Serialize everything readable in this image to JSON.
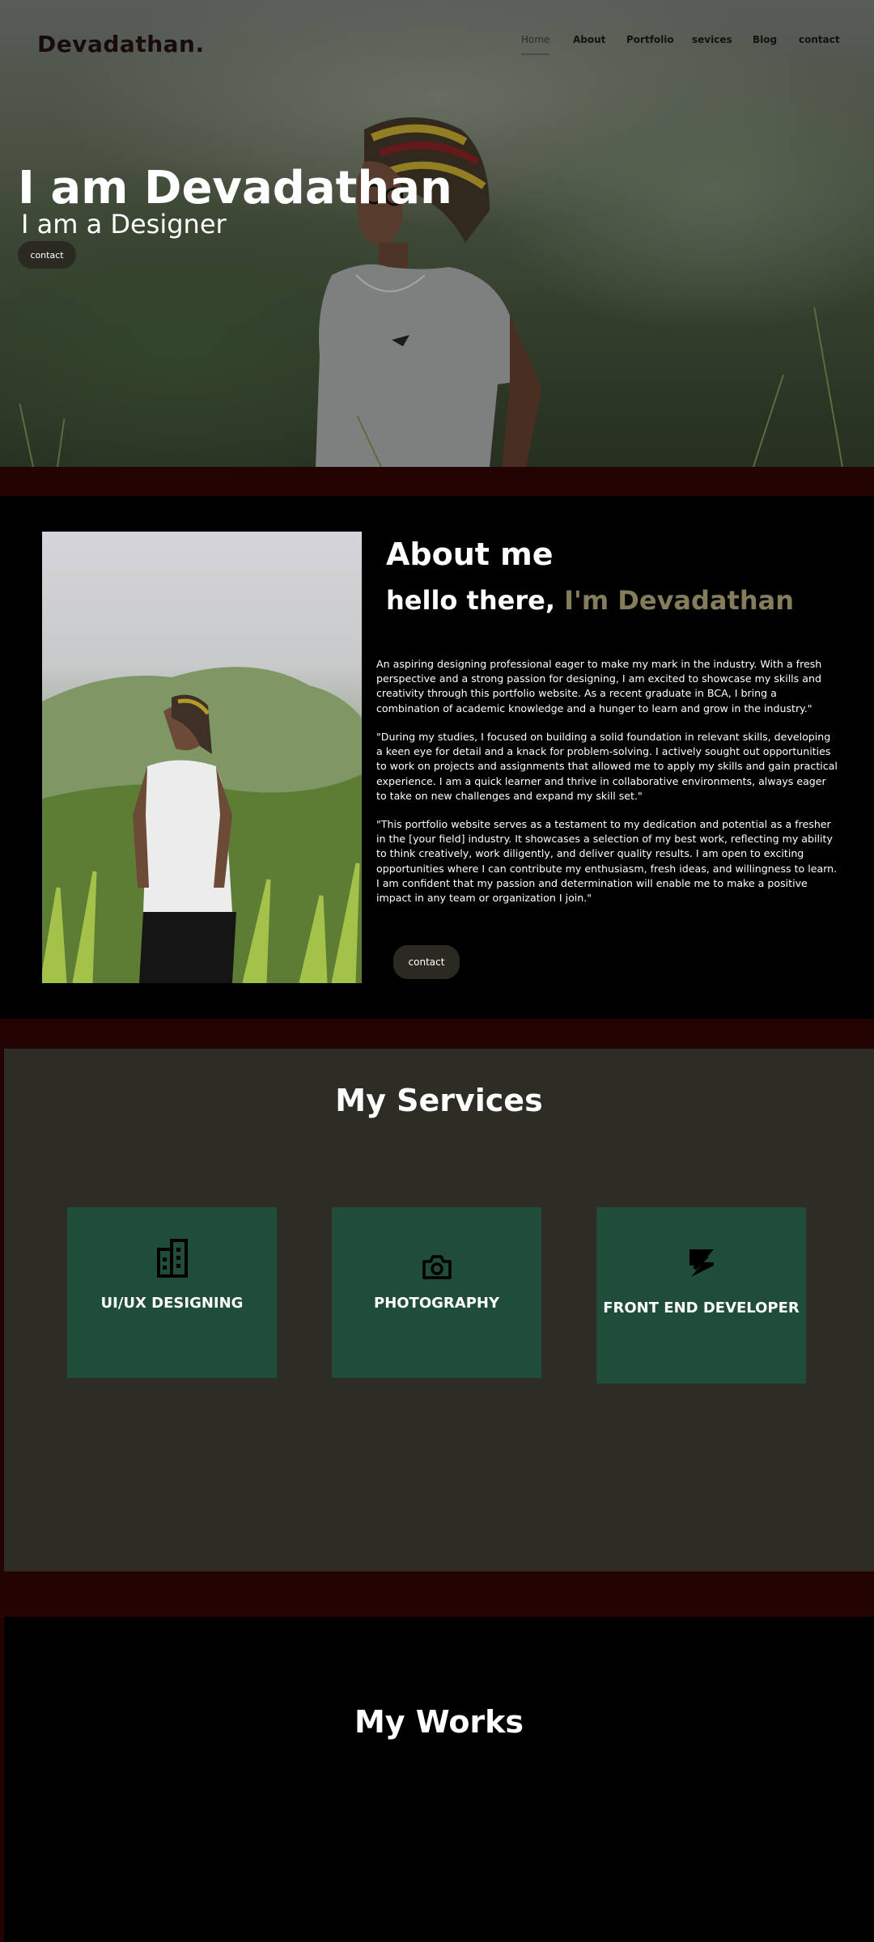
{
  "header": {
    "logo": "Devadathan.",
    "nav": [
      {
        "label": "Home",
        "active": true
      },
      {
        "label": "About",
        "active": false
      },
      {
        "label": "Portfolio",
        "active": false
      },
      {
        "label": "sevices",
        "active": false
      },
      {
        "label": "Blog",
        "active": false
      },
      {
        "label": "contact",
        "active": false
      }
    ]
  },
  "hero": {
    "title": "I am Devadathan",
    "subtitle": "I am a Designer",
    "button": "contact"
  },
  "about": {
    "title": "About me",
    "greeting": "hello  there, ",
    "greeting_name": "I'm Devadathan",
    "paragraphs": [
      "An aspiring designing professional eager to make my mark in the industry. With a fresh perspective and a strong passion for designing, I am excited to showcase my skills and creativity through this portfolio website. As a recent graduate in BCA, I bring a combination of academic knowledge and a hunger to learn and grow in the industry.\"",
      "\"During my studies, I focused on building a solid foundation in relevant skills, developing a keen eye for detail and a knack for problem-solving. I actively sought out opportunities to work on projects and assignments that allowed me to apply my skills and gain practical experience. I am a quick learner and thrive in collaborative environments, always eager to take on new challenges and expand my skill set.\"",
      "\"This portfolio website serves as a testament to my dedication and potential as a fresher in the [your field] industry. It showcases a selection of my best work, reflecting my ability to think creatively, work diligently, and deliver quality results. I am open to exciting opportunities where I can contribute my enthusiasm, fresh ideas, and willingness to learn. I am confident that my passion and determination will enable me to make a positive impact in any team or organization I join.\""
    ],
    "button": "contact"
  },
  "services": {
    "title": "My Services",
    "cards": [
      {
        "label": "UI/UX DESIGNING",
        "icon": "building-icon"
      },
      {
        "label": "PHOTOGRAPHY",
        "icon": "camera-icon"
      },
      {
        "label": "FRONT END DEVELOPER",
        "icon": "zend-logo-icon"
      }
    ]
  },
  "works": {
    "title": "My Works"
  },
  "colors": {
    "strip": "#240303",
    "services_bg": "#2e2d25",
    "card_bg": "#1f4d3a",
    "name_accent": "#857c5b",
    "button_bg": "#2b2a22"
  }
}
